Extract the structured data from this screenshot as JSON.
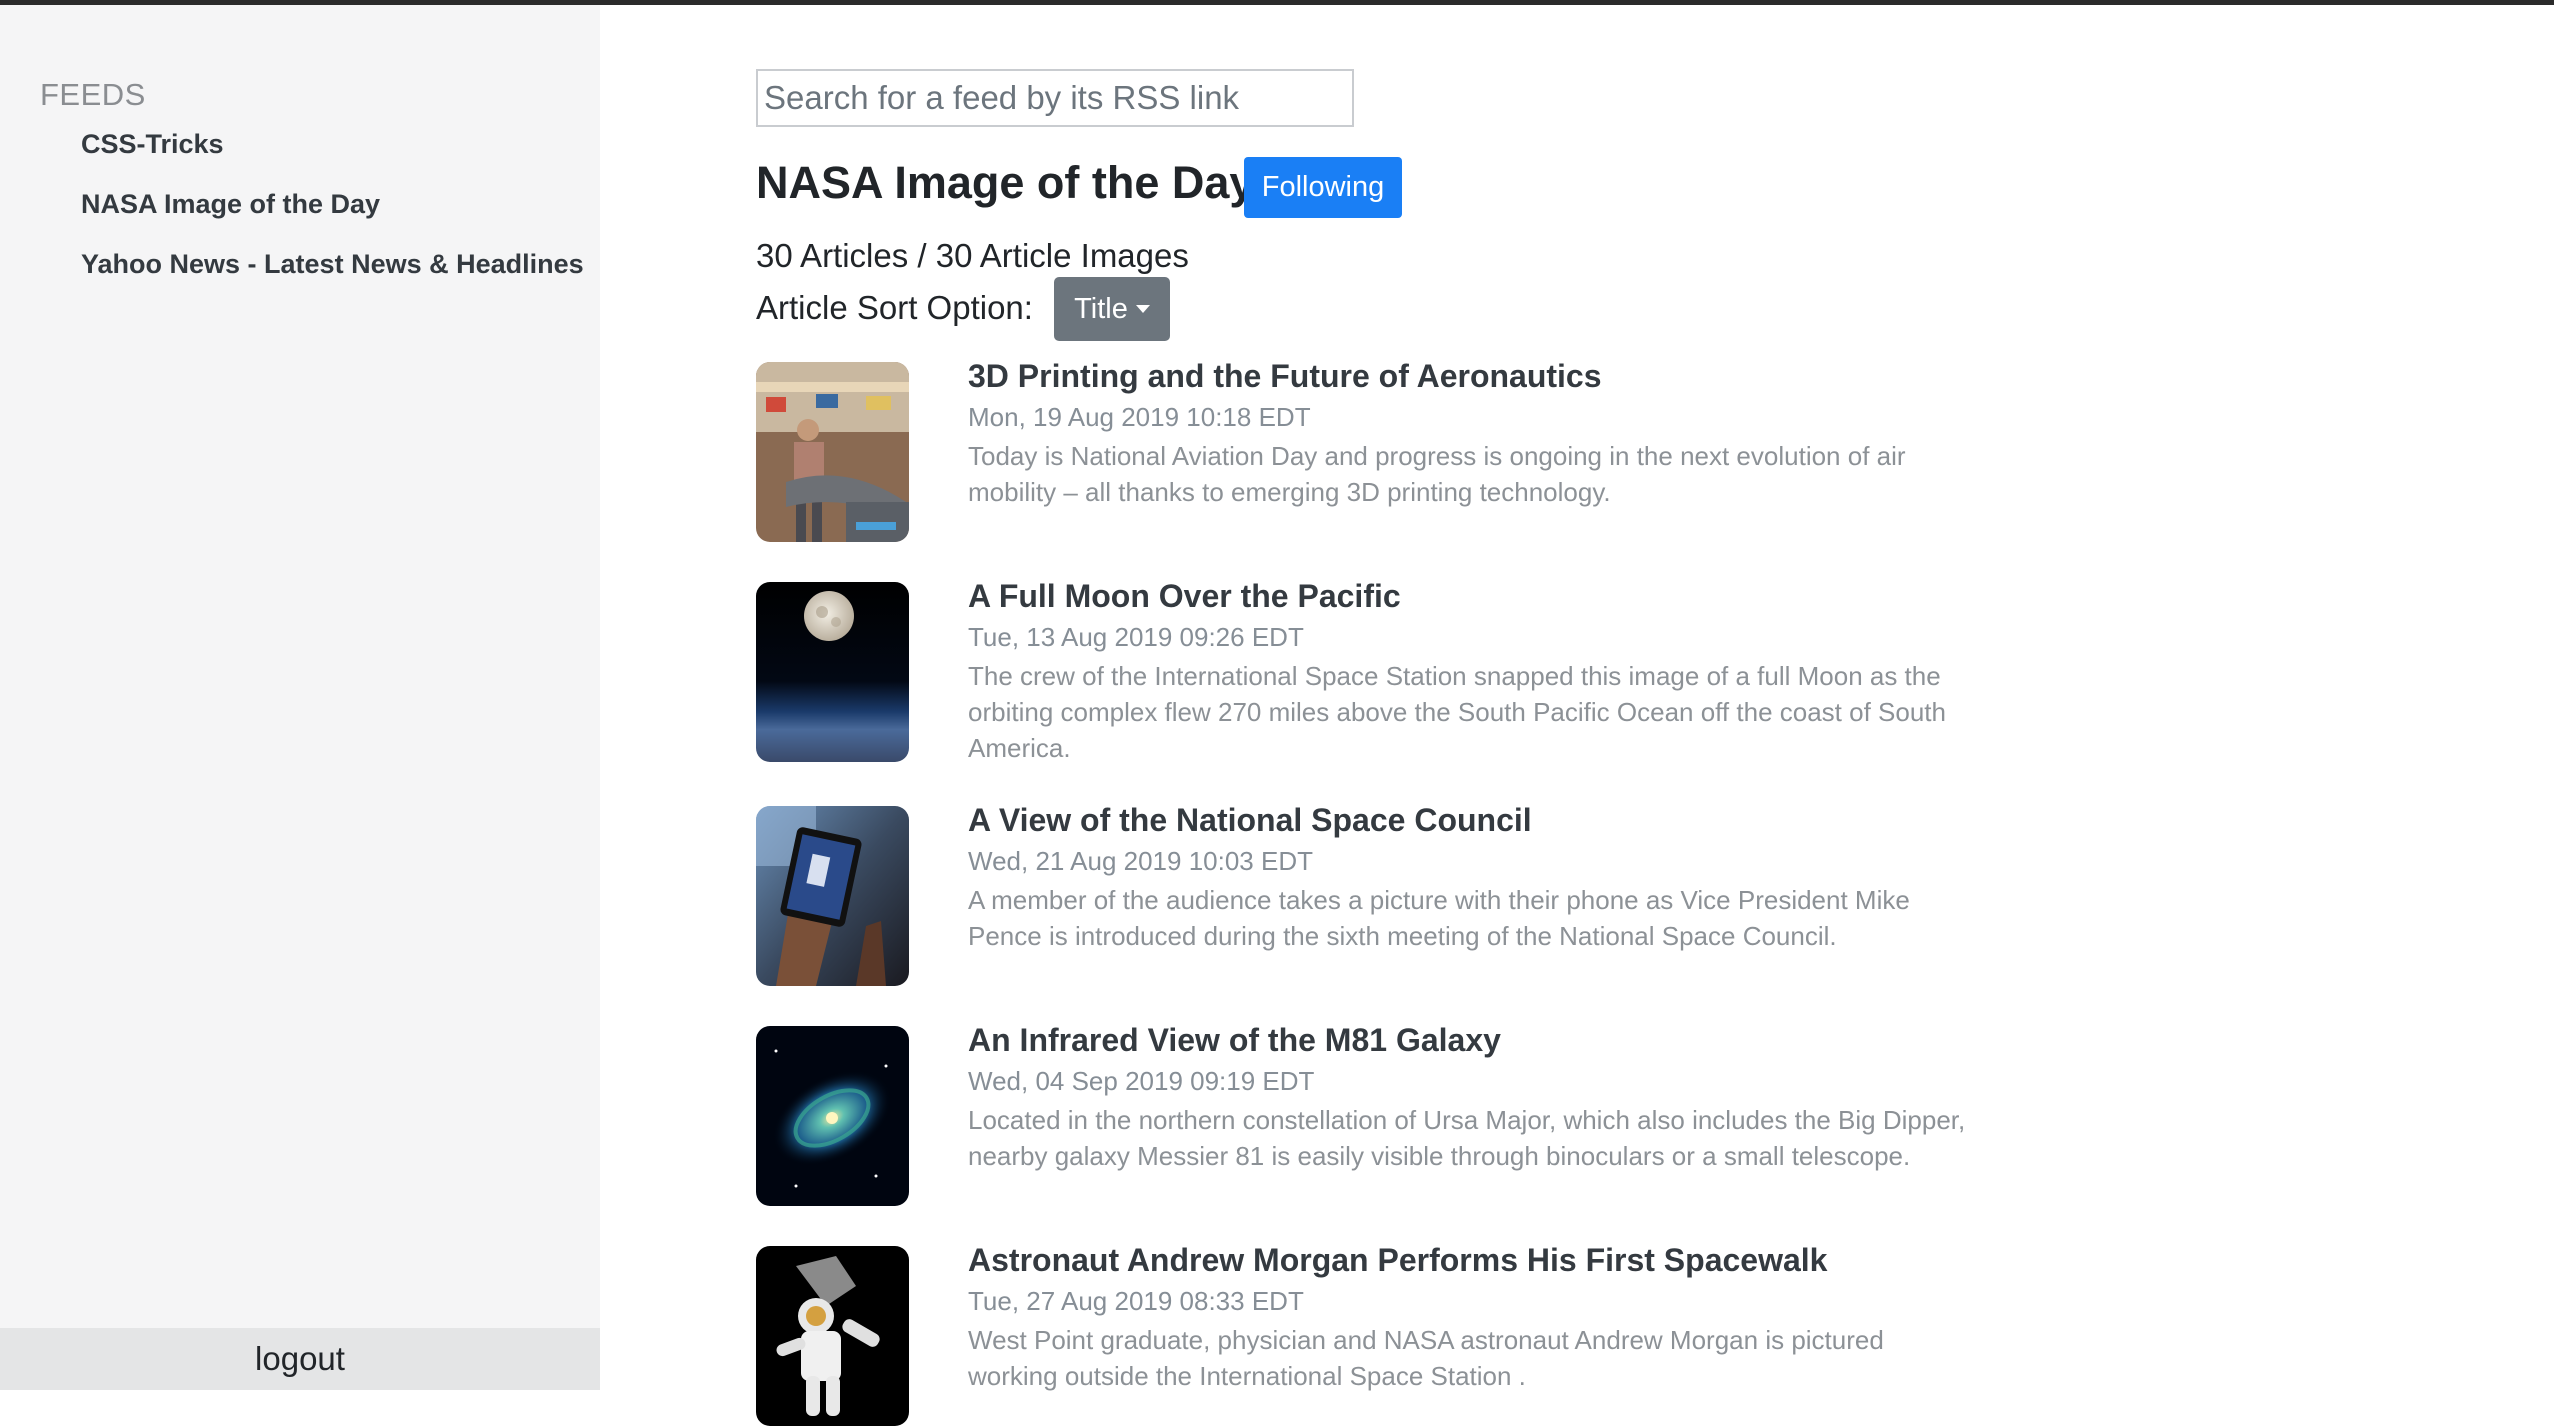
{
  "sidebar": {
    "heading": "FEEDS",
    "feeds": [
      {
        "label": "CSS-Tricks"
      },
      {
        "label": "NASA Image of the Day"
      },
      {
        "label": "Yahoo News - Latest News & Headlines"
      }
    ],
    "logout_label": "logout"
  },
  "search": {
    "placeholder": "Search for a feed by its RSS link",
    "value": ""
  },
  "feed": {
    "title": "NASA Image of the Day",
    "follow_label": "Following",
    "counts": "30 Articles / 30 Article Images",
    "sort_label": "Article Sort Option:",
    "sort_value": "Title"
  },
  "articles": [
    {
      "title": "3D Printing and the Future of Aeronautics",
      "date": "Mon, 19 Aug 2019 10:18 EDT",
      "description": "Today is National Aviation Day and progress is ongoing in the next evolution of air mobility – all thanks to emerging 3D printing technology.",
      "thumbnail": "3d-printing-photo"
    },
    {
      "title": "A Full Moon Over the Pacific",
      "date": "Tue, 13 Aug 2019 09:26 EDT",
      "description": "The crew of the International Space Station snapped this image of a full Moon as the orbiting complex flew 270 miles above the South Pacific Ocean off the coast of South America.",
      "thumbnail": "full-moon-photo"
    },
    {
      "title": "A View of the National Space Council",
      "date": "Wed, 21 Aug 2019 10:03 EDT",
      "description": "A member of the audience takes a picture with their phone as Vice President Mike Pence is introduced during the sixth meeting of the National Space Council.",
      "thumbnail": "phone-photo"
    },
    {
      "title": "An Infrared View of the M81 Galaxy",
      "date": "Wed, 04 Sep 2019 09:19 EDT",
      "description": "Located in the northern constellation of Ursa Major, which also includes the Big Dipper, nearby galaxy Messier 81 is easily visible through binoculars or a small telescope.",
      "thumbnail": "galaxy-photo"
    },
    {
      "title": "Astronaut Andrew Morgan Performs His First Spacewalk",
      "date": "Tue, 27 Aug 2019 08:33 EDT",
      "description": "West Point graduate, physician and NASA astronaut Andrew Morgan is pictured working outside the International Space Station .",
      "thumbnail": "spacewalk-photo"
    }
  ],
  "colors": {
    "accent": "#1a7ff5",
    "sort_button": "#6c757d",
    "sidebar_bg": "#f5f5f6"
  }
}
